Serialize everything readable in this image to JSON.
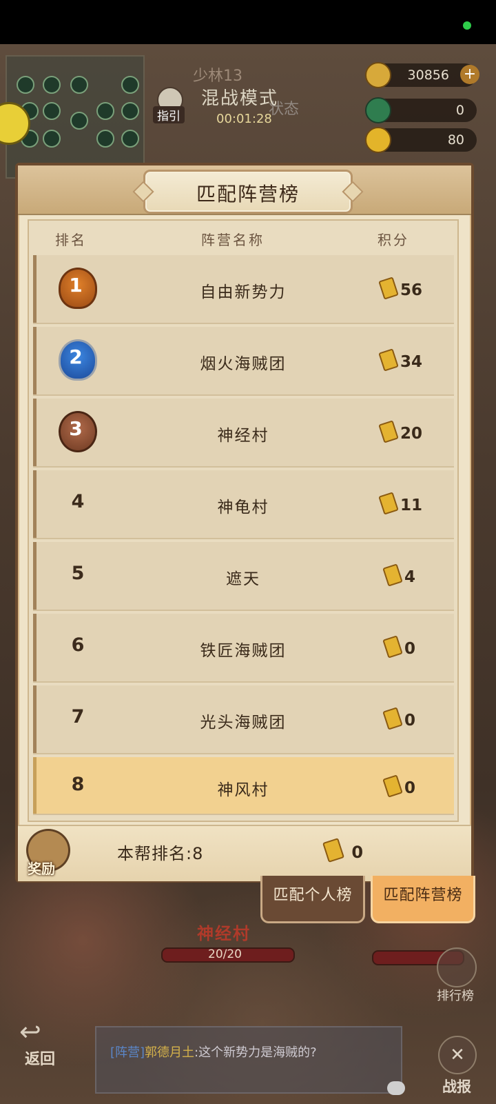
{
  "hud": {
    "map_title": "少林13",
    "mode": "混战模式",
    "state": "状态",
    "timer": "00:01:28",
    "guide_label": "指引"
  },
  "resources": [
    {
      "icon": "gold-ingot-icon",
      "value": "30856",
      "has_plus": true
    },
    {
      "icon": "jade-icon",
      "value": "0"
    },
    {
      "icon": "energy-icon",
      "value": "80"
    }
  ],
  "panel": {
    "title": "匹配阵营榜",
    "headers": {
      "rank": "排名",
      "name": "阵营名称",
      "score": "积分"
    },
    "rows": [
      {
        "rank": "1",
        "name": "自由新势力",
        "score": "56",
        "medal": "gold"
      },
      {
        "rank": "2",
        "name": "烟火海贼团",
        "score": "34",
        "medal": "silver"
      },
      {
        "rank": "3",
        "name": "神经村",
        "score": "20",
        "medal": "bronze"
      },
      {
        "rank": "4",
        "name": "神龟村",
        "score": "11"
      },
      {
        "rank": "5",
        "name": "遮天",
        "score": "4"
      },
      {
        "rank": "6",
        "name": "铁匠海贼团",
        "score": "0"
      },
      {
        "rank": "7",
        "name": "光头海贼团",
        "score": "0"
      },
      {
        "rank": "8",
        "name": "神风村",
        "score": "0",
        "highlight": true
      }
    ],
    "footer": {
      "reward_label": "奖励",
      "my_rank": "本帮排名:8",
      "my_score": "0"
    }
  },
  "tabs": {
    "personal": "匹配个人榜",
    "camp": "匹配阵营榜"
  },
  "bottom": {
    "camp_name": "神经村",
    "hp_left": "20/20",
    "rank_button": "排行榜",
    "back_button": "返回",
    "battle_report": "战报",
    "chat": {
      "camp_tag": "[阵营]",
      "nick": "郭德月土",
      "message": ":这个新势力是海贼的?"
    }
  },
  "colors": {
    "panel_bg": "#efe3c8",
    "highlight_row": "#f2d190",
    "active_tab": "#f2b062",
    "inactive_tab": "#6a4a34"
  }
}
